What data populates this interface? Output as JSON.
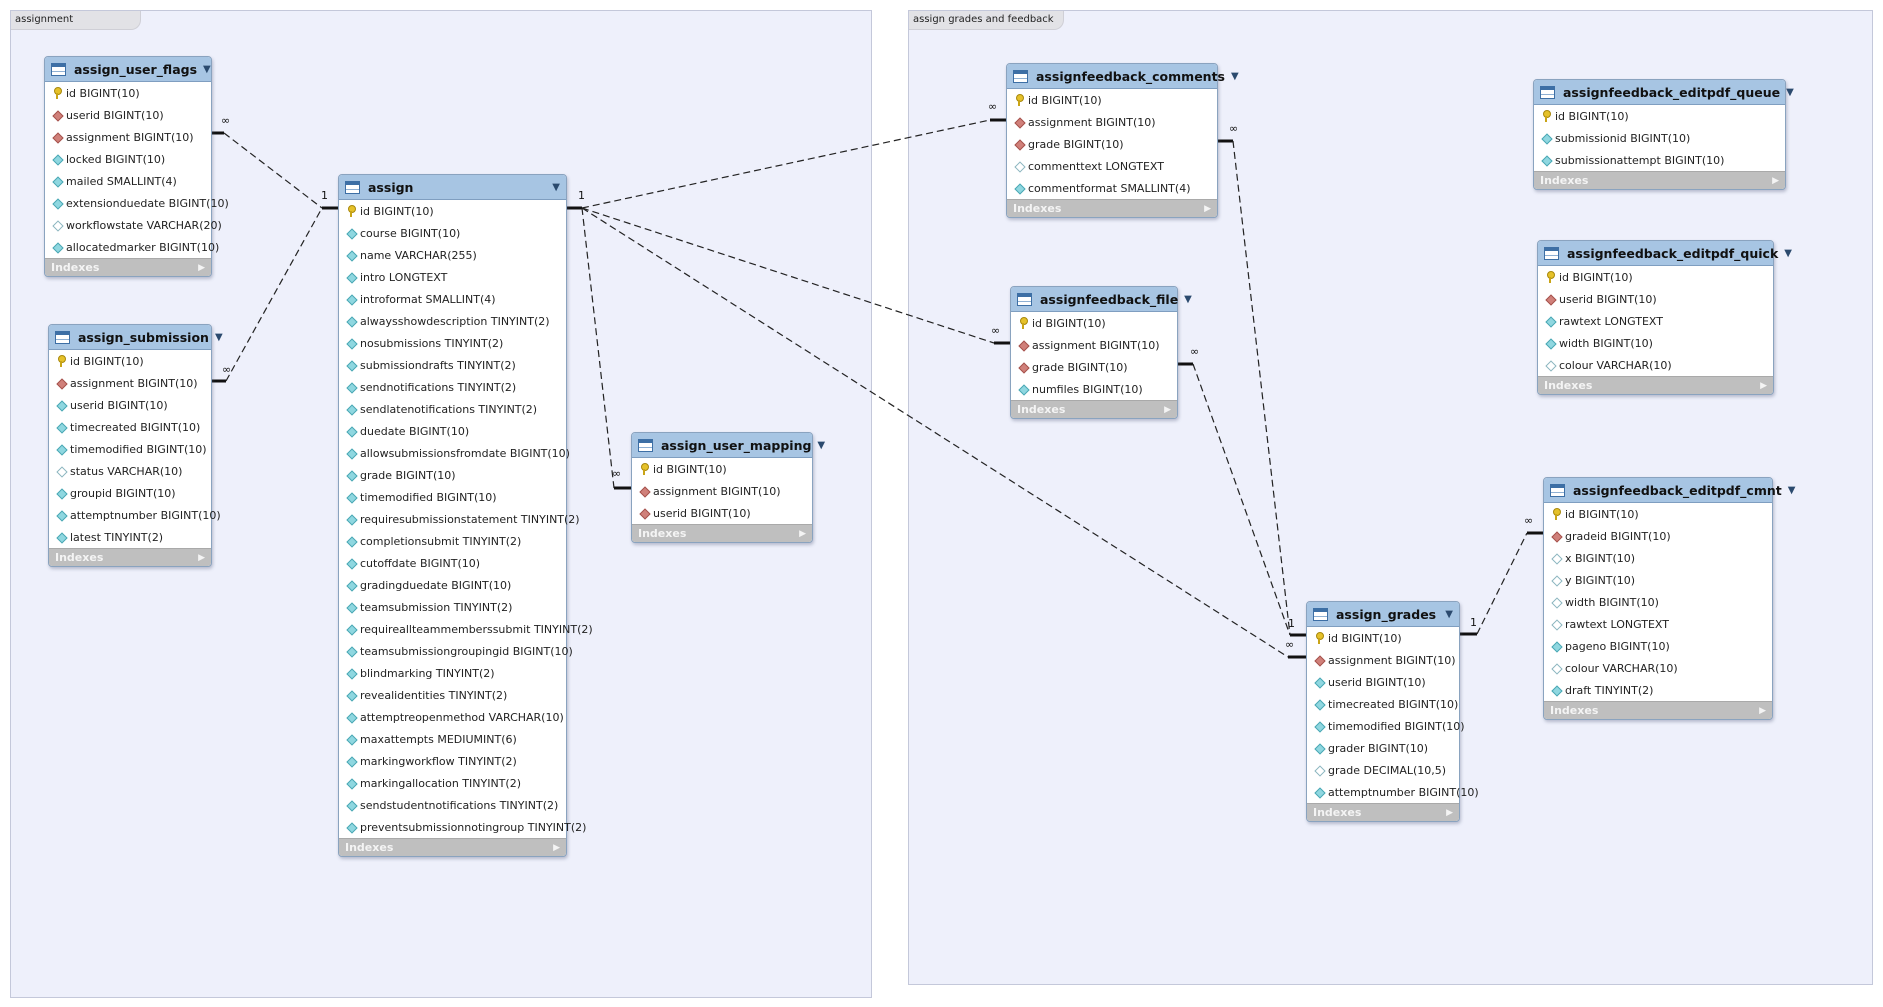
{
  "layers": [
    {
      "id": "assignment",
      "label": "assignment"
    },
    {
      "id": "grades",
      "label": "assign grades and feedback"
    }
  ],
  "cardinality": {
    "one": "1",
    "many": "∞"
  },
  "indexes_label": "Indexes",
  "tables": [
    {
      "id": "assign_user_flags",
      "name": "assign_user_flags",
      "columns": [
        {
          "name": "id BIGINT(10)",
          "icon": "pk"
        },
        {
          "name": "userid BIGINT(10)",
          "icon": "fk"
        },
        {
          "name": "assignment BIGINT(10)",
          "icon": "fk"
        },
        {
          "name": "locked BIGINT(10)",
          "icon": "col"
        },
        {
          "name": "mailed SMALLINT(4)",
          "icon": "col"
        },
        {
          "name": "extensionduedate BIGINT(10)",
          "icon": "col"
        },
        {
          "name": "workflowstate VARCHAR(20)",
          "icon": "nul"
        },
        {
          "name": "allocatedmarker BIGINT(10)",
          "icon": "col"
        }
      ]
    },
    {
      "id": "assign_submission",
      "name": "assign_submission",
      "columns": [
        {
          "name": "id BIGINT(10)",
          "icon": "pk"
        },
        {
          "name": "assignment BIGINT(10)",
          "icon": "fk"
        },
        {
          "name": "userid BIGINT(10)",
          "icon": "col"
        },
        {
          "name": "timecreated BIGINT(10)",
          "icon": "col"
        },
        {
          "name": "timemodified BIGINT(10)",
          "icon": "col"
        },
        {
          "name": "status VARCHAR(10)",
          "icon": "nul"
        },
        {
          "name": "groupid BIGINT(10)",
          "icon": "col"
        },
        {
          "name": "attemptnumber BIGINT(10)",
          "icon": "col"
        },
        {
          "name": "latest TINYINT(2)",
          "icon": "col"
        }
      ]
    },
    {
      "id": "assign",
      "name": "assign",
      "columns": [
        {
          "name": "id BIGINT(10)",
          "icon": "pk"
        },
        {
          "name": "course BIGINT(10)",
          "icon": "col"
        },
        {
          "name": "name VARCHAR(255)",
          "icon": "col"
        },
        {
          "name": "intro LONGTEXT",
          "icon": "col"
        },
        {
          "name": "introformat SMALLINT(4)",
          "icon": "col"
        },
        {
          "name": "alwaysshowdescription TINYINT(2)",
          "icon": "col"
        },
        {
          "name": "nosubmissions TINYINT(2)",
          "icon": "col"
        },
        {
          "name": "submissiondrafts TINYINT(2)",
          "icon": "col"
        },
        {
          "name": "sendnotifications TINYINT(2)",
          "icon": "col"
        },
        {
          "name": "sendlatenotifications TINYINT(2)",
          "icon": "col"
        },
        {
          "name": "duedate BIGINT(10)",
          "icon": "col"
        },
        {
          "name": "allowsubmissionsfromdate BIGINT(10)",
          "icon": "col"
        },
        {
          "name": "grade BIGINT(10)",
          "icon": "col"
        },
        {
          "name": "timemodified BIGINT(10)",
          "icon": "col"
        },
        {
          "name": "requiresubmissionstatement TINYINT(2)",
          "icon": "col"
        },
        {
          "name": "completionsubmit TINYINT(2)",
          "icon": "col"
        },
        {
          "name": "cutoffdate BIGINT(10)",
          "icon": "col"
        },
        {
          "name": "gradingduedate BIGINT(10)",
          "icon": "col"
        },
        {
          "name": "teamsubmission TINYINT(2)",
          "icon": "col"
        },
        {
          "name": "requireallteammemberssubmit TINYINT(2)",
          "icon": "col"
        },
        {
          "name": "teamsubmissiongroupingid BIGINT(10)",
          "icon": "col"
        },
        {
          "name": "blindmarking TINYINT(2)",
          "icon": "col"
        },
        {
          "name": "revealidentities TINYINT(2)",
          "icon": "col"
        },
        {
          "name": "attemptreopenmethod VARCHAR(10)",
          "icon": "col"
        },
        {
          "name": "maxattempts MEDIUMINT(6)",
          "icon": "col"
        },
        {
          "name": "markingworkflow TINYINT(2)",
          "icon": "col"
        },
        {
          "name": "markingallocation TINYINT(2)",
          "icon": "col"
        },
        {
          "name": "sendstudentnotifications TINYINT(2)",
          "icon": "col"
        },
        {
          "name": "preventsubmissionnotingroup TINYINT(2)",
          "icon": "col"
        }
      ]
    },
    {
      "id": "assign_user_mapping",
      "name": "assign_user_mapping",
      "columns": [
        {
          "name": "id BIGINT(10)",
          "icon": "pk"
        },
        {
          "name": "assignment BIGINT(10)",
          "icon": "fk"
        },
        {
          "name": "userid BIGINT(10)",
          "icon": "fk"
        }
      ]
    },
    {
      "id": "assignfeedback_comments",
      "name": "assignfeedback_comments",
      "columns": [
        {
          "name": "id BIGINT(10)",
          "icon": "pk"
        },
        {
          "name": "assignment BIGINT(10)",
          "icon": "fk"
        },
        {
          "name": "grade BIGINT(10)",
          "icon": "fk"
        },
        {
          "name": "commenttext LONGTEXT",
          "icon": "nul"
        },
        {
          "name": "commentformat SMALLINT(4)",
          "icon": "col"
        }
      ]
    },
    {
      "id": "assignfeedback_file",
      "name": "assignfeedback_file",
      "columns": [
        {
          "name": "id BIGINT(10)",
          "icon": "pk"
        },
        {
          "name": "assignment BIGINT(10)",
          "icon": "fk"
        },
        {
          "name": "grade BIGINT(10)",
          "icon": "fk"
        },
        {
          "name": "numfiles BIGINT(10)",
          "icon": "col"
        }
      ]
    },
    {
      "id": "assignfeedback_editpdf_queue",
      "name": "assignfeedback_editpdf_queue",
      "columns": [
        {
          "name": "id BIGINT(10)",
          "icon": "pk"
        },
        {
          "name": "submissionid BIGINT(10)",
          "icon": "col"
        },
        {
          "name": "submissionattempt BIGINT(10)",
          "icon": "col"
        }
      ]
    },
    {
      "id": "assignfeedback_editpdf_quick",
      "name": "assignfeedback_editpdf_quick",
      "columns": [
        {
          "name": "id BIGINT(10)",
          "icon": "pk"
        },
        {
          "name": "userid BIGINT(10)",
          "icon": "fk"
        },
        {
          "name": "rawtext LONGTEXT",
          "icon": "col"
        },
        {
          "name": "width BIGINT(10)",
          "icon": "col"
        },
        {
          "name": "colour VARCHAR(10)",
          "icon": "nul"
        }
      ]
    },
    {
      "id": "assignfeedback_editpdf_cmnt",
      "name": "assignfeedback_editpdf_cmnt",
      "columns": [
        {
          "name": "id BIGINT(10)",
          "icon": "pk"
        },
        {
          "name": "gradeid BIGINT(10)",
          "icon": "fk"
        },
        {
          "name": "x BIGINT(10)",
          "icon": "nul"
        },
        {
          "name": "y BIGINT(10)",
          "icon": "nul"
        },
        {
          "name": "width BIGINT(10)",
          "icon": "nul"
        },
        {
          "name": "rawtext LONGTEXT",
          "icon": "nul"
        },
        {
          "name": "pageno BIGINT(10)",
          "icon": "col"
        },
        {
          "name": "colour VARCHAR(10)",
          "icon": "nul"
        },
        {
          "name": "draft TINYINT(2)",
          "icon": "col"
        }
      ]
    },
    {
      "id": "assign_grades",
      "name": "assign_grades",
      "columns": [
        {
          "name": "id BIGINT(10)",
          "icon": "pk"
        },
        {
          "name": "assignment BIGINT(10)",
          "icon": "fk"
        },
        {
          "name": "userid BIGINT(10)",
          "icon": "col"
        },
        {
          "name": "timecreated BIGINT(10)",
          "icon": "col"
        },
        {
          "name": "timemodified BIGINT(10)",
          "icon": "col"
        },
        {
          "name": "grader BIGINT(10)",
          "icon": "col"
        },
        {
          "name": "grade DECIMAL(10,5)",
          "icon": "nul"
        },
        {
          "name": "attemptnumber BIGINT(10)",
          "icon": "col"
        }
      ]
    }
  ]
}
